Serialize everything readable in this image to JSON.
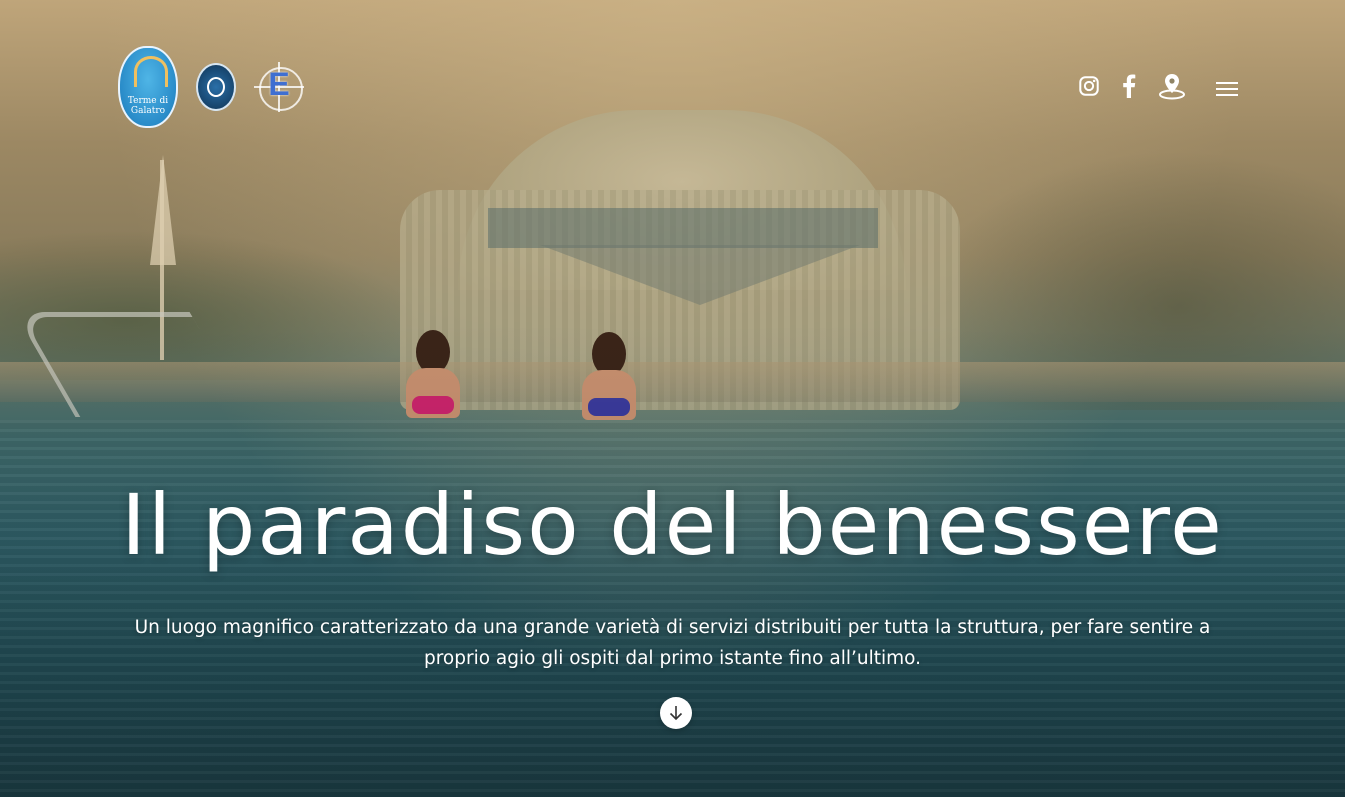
{
  "header": {
    "logos": {
      "main_logo_text": "Terme di Galatro",
      "accredia_logo": "accredia-logo",
      "e_logo_letter": "E"
    },
    "social": [
      {
        "icon": "instagram-icon"
      },
      {
        "icon": "facebook-icon"
      },
      {
        "icon": "map-pin-icon"
      },
      {
        "icon": "hamburger-menu-icon"
      }
    ]
  },
  "hero": {
    "title": "Il paradiso del benessere",
    "subtitle": "Un luogo magnifico caratterizzato da una grande varietà di servizi distribuiti per tutta la struttura, per fare sentire a proprio agio gli ospiti dal primo istante fino all’ultimo.",
    "scroll_icon": "arrow-down-icon"
  },
  "colors": {
    "text": "#ffffff",
    "logo_blue": "#2a8cc9",
    "logo_e_blue": "#3f6fd1",
    "water_teal": "#2f5f68"
  }
}
